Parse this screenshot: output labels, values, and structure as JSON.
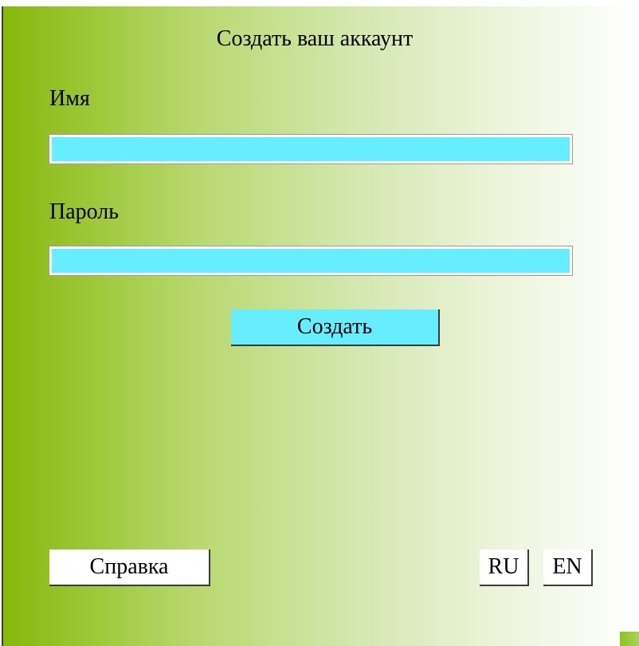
{
  "form": {
    "title": "Создать ваш аккаунт",
    "name_label": "Имя",
    "name_value": "",
    "password_label": "Пароль",
    "password_value": "",
    "create_label": "Создать"
  },
  "footer": {
    "help_label": "Справка",
    "lang_ru_label": "RU",
    "lang_en_label": "EN"
  },
  "colors": {
    "gradient_left": "#86b80a",
    "gradient_right": "#ffffff",
    "input_fill": "#66eeff",
    "button_fill": "#66eeff"
  },
  "icons": {
    "resize_grip": "resize-grip-icon"
  }
}
